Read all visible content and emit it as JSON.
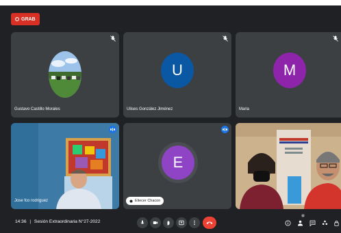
{
  "recording": {
    "label": "GRAB"
  },
  "participants": [
    {
      "name": "Gustavo Castillo Morales",
      "type": "photo",
      "muted": true
    },
    {
      "name": "Ulises González Jiménez",
      "type": "avatar",
      "initial": "U",
      "color": "#0a57a4",
      "muted": true
    },
    {
      "name": "Maria",
      "type": "avatar",
      "initial": "M",
      "color": "#8e24aa",
      "muted": true
    },
    {
      "name": "Jose fco rodriguez",
      "type": "video",
      "speaking": true
    },
    {
      "name": "Eliecer Chacon",
      "type": "avatar",
      "initial": "E",
      "color": "#8e44c4",
      "speaking": true,
      "pinned_label": true
    },
    {
      "name": "",
      "type": "video",
      "muted": false
    }
  ],
  "bottom_bar": {
    "time": "14:36",
    "separator": "|",
    "meeting_title": "Sesión Extraordinaria N°27-2022",
    "controls": [
      "mic-icon",
      "camera-icon",
      "hand-icon",
      "present-icon",
      "more-icon",
      "hangup-icon"
    ],
    "right_icons": [
      "info-icon",
      "people-icon",
      "chat-icon",
      "activities-icon",
      "lock-icon"
    ],
    "people_count": "6"
  },
  "colors": {
    "bg": "#202124",
    "tile": "#3c4043",
    "accent": "#1a73e8",
    "hangup": "#ea4335"
  }
}
